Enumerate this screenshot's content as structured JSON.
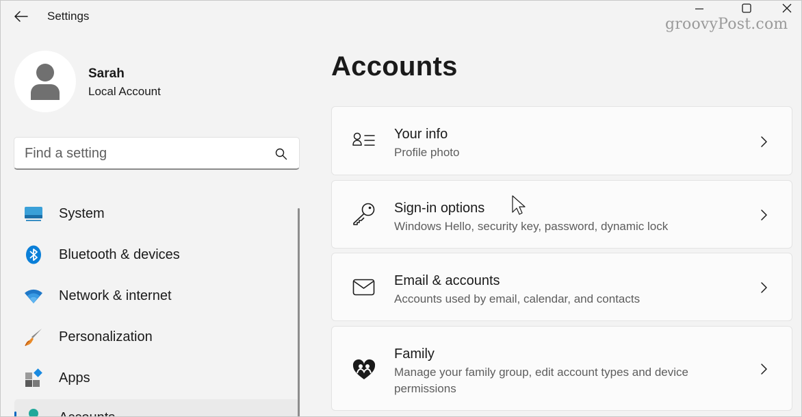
{
  "window": {
    "app_title": "Settings",
    "watermark": "groovyPost.com"
  },
  "profile": {
    "name": "Sarah",
    "account_type": "Local Account"
  },
  "search": {
    "placeholder": "Find a setting",
    "value": ""
  },
  "sidebar": {
    "items": [
      {
        "label": "System",
        "icon": "system-icon"
      },
      {
        "label": "Bluetooth & devices",
        "icon": "bluetooth-icon"
      },
      {
        "label": "Network & internet",
        "icon": "wifi-icon"
      },
      {
        "label": "Personalization",
        "icon": "paintbrush-icon"
      },
      {
        "label": "Apps",
        "icon": "apps-icon"
      },
      {
        "label": "Accounts",
        "icon": "accounts-icon",
        "selected": true
      }
    ]
  },
  "main": {
    "title": "Accounts",
    "cards": [
      {
        "title": "Your info",
        "subtitle": "Profile photo",
        "icon": "person-info-icon"
      },
      {
        "title": "Sign-in options",
        "subtitle": "Windows Hello, security key, password, dynamic lock",
        "icon": "key-icon"
      },
      {
        "title": "Email & accounts",
        "subtitle": "Accounts used by email, calendar, and contacts",
        "icon": "mail-icon"
      },
      {
        "title": "Family",
        "subtitle": "Manage your family group, edit account types and device permissions",
        "icon": "family-heart-icon"
      }
    ]
  },
  "colors": {
    "accent": "#0067c0",
    "background": "#f3f3f3",
    "card": "#fbfbfb"
  }
}
